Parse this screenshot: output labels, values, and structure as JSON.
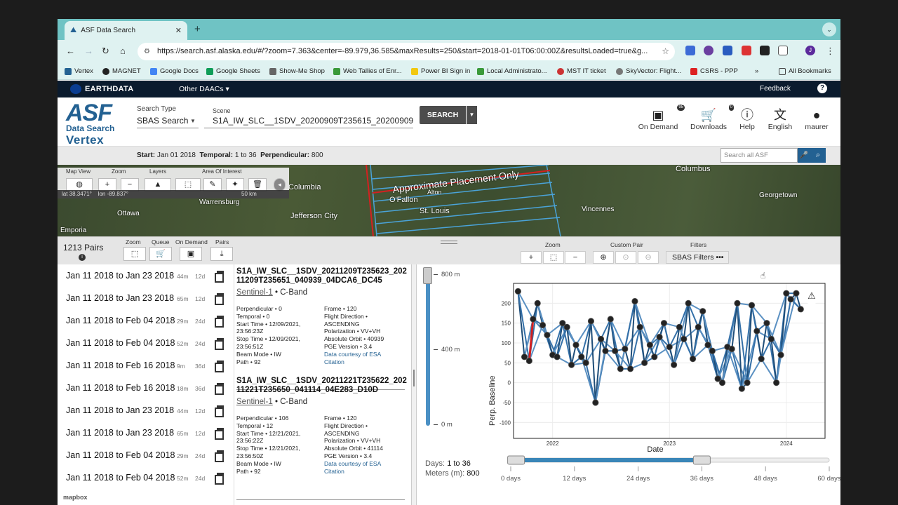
{
  "browser": {
    "tab_title": "ASF Data Search",
    "url": "https://search.asf.alaska.edu/#/?zoom=7.363&center=-89.979,36.585&maxResults=250&start=2018-01-01T06:00:00Z&resultsLoaded=true&g...",
    "bookmarks": [
      "Vertex",
      "MAGNET",
      "Google Docs",
      "Google Sheets",
      "Show-Me Shop",
      "Web Tallies of Enr...",
      "Power BI Sign in",
      "Local Administrato...",
      "MST IT ticket",
      "SkyVector: Flight...",
      "CSRS - PPP"
    ],
    "all_bookmarks": "All Bookmarks"
  },
  "earthdata": {
    "brand": "EARTHDATA",
    "other_daacs": "Other DAACs ▾",
    "feedback": "Feedback"
  },
  "header": {
    "logo_line1": "ASF",
    "logo_line2": "Data Search",
    "logo_line3": "Vertex",
    "search_type_label": "Search Type",
    "search_type_value": "SBAS Search",
    "scene_label": "Scene",
    "scene_value": "S1A_IW_SLC__1SDV_20200909T235615_20200909T",
    "search_button": "SEARCH",
    "on_demand": "On Demand",
    "on_demand_count": "95",
    "downloads": "Downloads",
    "downloads_count": "0",
    "help": "Help",
    "language": "English",
    "user": "maurer"
  },
  "filters": {
    "start_label": "Start:",
    "start_value": "Jan 01 2018",
    "temporal_label": "Temporal:",
    "temporal_value": "1 to 36",
    "perp_label": "Perpendicular:",
    "perp_value": "800",
    "search_all_placeholder": "Search all ASF"
  },
  "map": {
    "controls": {
      "map_view": "Map View",
      "zoom": "Zoom",
      "layers": "Layers",
      "aoi": "Area Of Interest"
    },
    "lat": "lat 38.3471°",
    "lon": "lon -89.837°",
    "scale": "50 km",
    "labels": [
      "Columbus",
      "Columbia",
      "Warrensburg",
      "Jefferson City",
      "O'Fallon",
      "Alton",
      "St. Louis",
      "Vincennes",
      "Georgetown",
      "Ottawa",
      "Emporia"
    ],
    "overlay_text": "Approximate Placement Only",
    "attribution": "mapbox"
  },
  "results": {
    "pairs_count": "1213 Pairs",
    "toolbar": {
      "zoom": "Zoom",
      "queue": "Queue",
      "on_demand": "On Demand",
      "pairs": "Pairs"
    },
    "chart_toolbar": {
      "zoom": "Zoom",
      "custom_pair": "Custom Pair",
      "filters": "Filters",
      "sbas_filters": "SBAS Filters"
    },
    "list": [
      {
        "dates": "Jan 11 2018 to Jan 23 2018",
        "meters": "44m",
        "days": "12d"
      },
      {
        "dates": "Jan 11 2018 to Jan 23 2018",
        "meters": "65m",
        "days": "12d"
      },
      {
        "dates": "Jan 11 2018 to Feb 04 2018",
        "meters": "29m",
        "days": "24d"
      },
      {
        "dates": "Jan 11 2018 to Feb 04 2018",
        "meters": "52m",
        "days": "24d"
      },
      {
        "dates": "Jan 11 2018 to Feb 16 2018",
        "meters": "9m",
        "days": "36d"
      },
      {
        "dates": "Jan 11 2018 to Feb 16 2018",
        "meters": "18m",
        "days": "36d"
      },
      {
        "dates": "Jan 11 2018 to Jan 23 2018",
        "meters": "44m",
        "days": "12d"
      },
      {
        "dates": "Jan 11 2018 to Jan 23 2018",
        "meters": "65m",
        "days": "12d"
      },
      {
        "dates": "Jan 11 2018 to Feb 04 2018",
        "meters": "29m",
        "days": "24d"
      },
      {
        "dates": "Jan 11 2018 to Feb 04 2018",
        "meters": "52m",
        "days": "24d"
      }
    ],
    "scenes": [
      {
        "name": "S1A_IW_SLC__1SDV_20211209T235623_20211209T235651_040939_04DCA6_DC45",
        "platform": "Sentinel-1",
        "band": " • C-Band",
        "left": {
          "perpendicular": "Perpendicular • 0",
          "temporal": "Temporal • 0",
          "start": "Start Time • 12/09/2021, 23:56:23Z",
          "stop": "Stop Time • 12/09/2021, 23:56:51Z",
          "beam": "Beam Mode • IW",
          "path": "Path • 92"
        },
        "right": {
          "frame": "Frame • 120",
          "flight_dir_label": "Flight Direction •",
          "flight_dir": "ASCENDING",
          "polarization": "Polarization • VV+VH",
          "orbit": "Absolute Orbit • 40939",
          "pge": "PGE Version • 3.4",
          "courtesy": "Data courtesy of ESA",
          "citation": "Citation"
        }
      },
      {
        "name": "S1A_IW_SLC__1SDV_20211221T235622_20211221T235650_041114_04E283_D10D",
        "platform": "Sentinel-1",
        "band": " • C-Band",
        "left": {
          "perpendicular": "Perpendicular • 106",
          "temporal": "Temporal • 12",
          "start": "Start Time • 12/21/2021, 23:56:22Z",
          "stop": "Stop Time • 12/21/2021, 23:56:50Z",
          "beam": "Beam Mode • IW",
          "path": "Path • 92"
        },
        "right": {
          "frame": "Frame • 120",
          "flight_dir_label": "Flight Direction •",
          "flight_dir": "ASCENDING",
          "polarization": "Polarization • VV+VH",
          "orbit": "Absolute Orbit • 41114",
          "pge": "PGE Version • 3.4",
          "courtesy": "Data courtesy of ESA",
          "citation": "Citation"
        }
      }
    ],
    "meters_slider": {
      "top": "800 m",
      "mid": "400 m",
      "bottom": "0 m",
      "selected_max_m": 800
    },
    "days_summary": {
      "days_label": "Days:",
      "days_value": "1 to 36",
      "meters_label": "Meters (m):",
      "meters_value": "800"
    },
    "days_slider": {
      "ticks": [
        "0 days",
        "12 days",
        "24 days",
        "36 days",
        "48 days",
        "60 days"
      ],
      "selected_min": 1,
      "selected_max": 36
    }
  },
  "chart_data": {
    "type": "scatter",
    "xlabel": "Date",
    "ylabel": "Perp. Baseline",
    "x_ticks": [
      "2022",
      "2023",
      "2024"
    ],
    "y_ticks": [
      200,
      150,
      100,
      50,
      0,
      -50,
      -100
    ],
    "xlim": [
      "2021-09",
      "2024-05"
    ],
    "ylim": [
      -140,
      250
    ],
    "colors": {
      "connection": "#1f4e79",
      "highlight": "#d42020",
      "point": "#222222"
    },
    "points": [
      {
        "x": "2021-09-15",
        "y": 230
      },
      {
        "x": "2021-10-05",
        "y": 65
      },
      {
        "x": "2021-10-20",
        "y": 55
      },
      {
        "x": "2021-11-01",
        "y": 160
      },
      {
        "x": "2021-11-15",
        "y": 200
      },
      {
        "x": "2021-12-01",
        "y": 145
      },
      {
        "x": "2021-12-15",
        "y": 120
      },
      {
        "x": "2022-01-01",
        "y": 70
      },
      {
        "x": "2022-01-15",
        "y": 65
      },
      {
        "x": "2022-02-01",
        "y": 150
      },
      {
        "x": "2022-02-15",
        "y": 140
      },
      {
        "x": "2022-03-01",
        "y": 45
      },
      {
        "x": "2022-03-15",
        "y": 95
      },
      {
        "x": "2022-04-01",
        "y": 65
      },
      {
        "x": "2022-04-15",
        "y": 50
      },
      {
        "x": "2022-05-01",
        "y": 155
      },
      {
        "x": "2022-05-15",
        "y": -50
      },
      {
        "x": "2022-06-01",
        "y": 110
      },
      {
        "x": "2022-06-15",
        "y": 80
      },
      {
        "x": "2022-07-01",
        "y": 160
      },
      {
        "x": "2022-07-15",
        "y": 80
      },
      {
        "x": "2022-08-01",
        "y": 35
      },
      {
        "x": "2022-08-15",
        "y": 85
      },
      {
        "x": "2022-09-01",
        "y": 35
      },
      {
        "x": "2022-09-15",
        "y": 205
      },
      {
        "x": "2022-10-01",
        "y": 140
      },
      {
        "x": "2022-10-15",
        "y": 50
      },
      {
        "x": "2022-11-01",
        "y": 95
      },
      {
        "x": "2022-11-15",
        "y": 65
      },
      {
        "x": "2022-12-01",
        "y": 115
      },
      {
        "x": "2022-12-15",
        "y": 150
      },
      {
        "x": "2023-01-01",
        "y": 90
      },
      {
        "x": "2023-01-15",
        "y": 45
      },
      {
        "x": "2023-02-01",
        "y": 140
      },
      {
        "x": "2023-02-15",
        "y": 110
      },
      {
        "x": "2023-03-01",
        "y": 200
      },
      {
        "x": "2023-03-15",
        "y": 60
      },
      {
        "x": "2023-04-01",
        "y": 140
      },
      {
        "x": "2023-04-15",
        "y": 180
      },
      {
        "x": "2023-05-01",
        "y": 95
      },
      {
        "x": "2023-05-15",
        "y": 80
      },
      {
        "x": "2023-06-01",
        "y": 10
      },
      {
        "x": "2023-06-15",
        "y": 0
      },
      {
        "x": "2023-07-01",
        "y": 90
      },
      {
        "x": "2023-07-15",
        "y": 85
      },
      {
        "x": "2023-08-01",
        "y": 200
      },
      {
        "x": "2023-08-15",
        "y": -15
      },
      {
        "x": "2023-09-01",
        "y": 0
      },
      {
        "x": "2023-09-15",
        "y": 195
      },
      {
        "x": "2023-10-01",
        "y": 130
      },
      {
        "x": "2023-10-15",
        "y": 60
      },
      {
        "x": "2023-11-01",
        "y": 150
      },
      {
        "x": "2023-11-15",
        "y": 110
      },
      {
        "x": "2023-12-01",
        "y": 0
      },
      {
        "x": "2023-12-15",
        "y": 70
      },
      {
        "x": "2024-01-01",
        "y": 225
      },
      {
        "x": "2024-01-15",
        "y": 210
      },
      {
        "x": "2024-02-01",
        "y": 225
      },
      {
        "x": "2024-02-15",
        "y": 185
      }
    ],
    "highlight_pair": [
      3,
      2
    ]
  }
}
